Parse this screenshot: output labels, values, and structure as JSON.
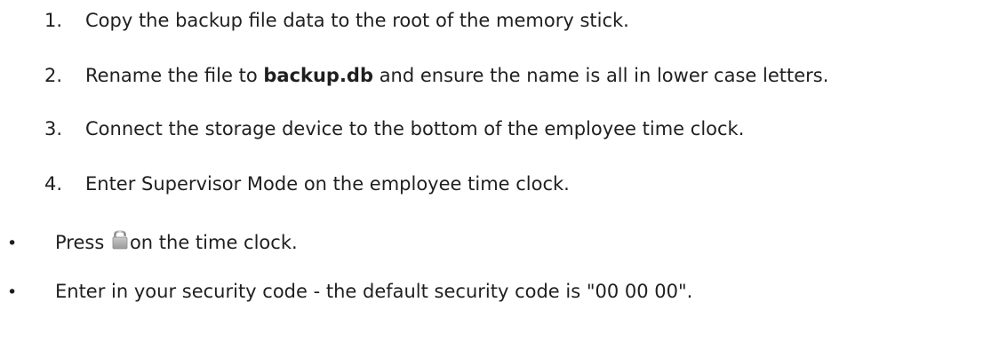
{
  "steps": [
    {
      "number": "1.",
      "text": "Copy the backup file data to the root of the memory stick."
    },
    {
      "number": "2.",
      "text_before": "Rename the file to ",
      "bold": "backup.db",
      "text_after": " and ensure the name is all in lower case letters."
    },
    {
      "number": "3.",
      "text": "Connect the storage device to the bottom of the employee time clock."
    },
    {
      "number": "4.",
      "text": "Enter Supervisor Mode on the employee time clock."
    }
  ],
  "bullets": [
    {
      "marker": "•",
      "text_before": "Press ",
      "icon": "lock-icon",
      "text_after": "on the time clock."
    },
    {
      "marker": "•",
      "text": "Enter in your security code - the default security code is \"00 00 00\"."
    }
  ]
}
